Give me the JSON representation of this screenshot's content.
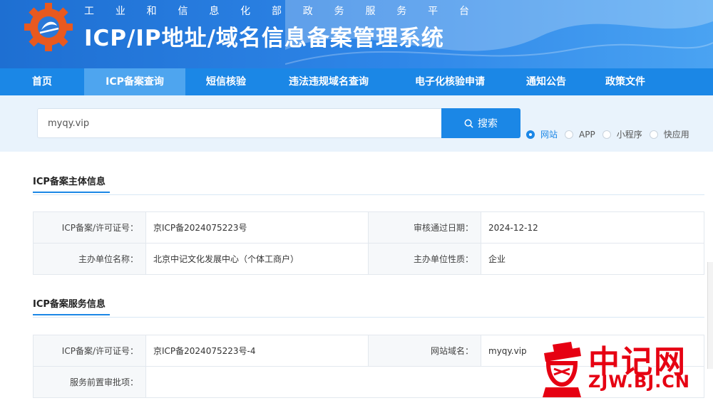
{
  "header": {
    "subtitle_chars": [
      "工",
      "业",
      "和",
      "信",
      "息",
      "化",
      "部",
      "政",
      "务",
      "服",
      "务",
      "平",
      "台"
    ],
    "title": "ICP/IP地址/域名信息备案管理系统"
  },
  "nav": {
    "items": [
      {
        "label": "首页",
        "width": 118
      },
      {
        "label": "ICP备案查询",
        "width": 142,
        "active": true
      },
      {
        "label": "短信核验",
        "width": 114
      },
      {
        "label": "违法违规域名查询",
        "width": 174
      },
      {
        "label": "电子化核验申请",
        "width": 166
      },
      {
        "label": "通知公告",
        "width": 104
      },
      {
        "label": "政策文件",
        "width": 118
      }
    ]
  },
  "search": {
    "value": "myqy.vip",
    "button_label": "搜索",
    "options": [
      {
        "label": "网站",
        "checked": true
      },
      {
        "label": "APP",
        "checked": false
      },
      {
        "label": "小程序",
        "checked": false
      },
      {
        "label": "快应用",
        "checked": false
      }
    ]
  },
  "subject": {
    "title": "ICP备案主体信息",
    "license_label": "ICP备案/许可证号：",
    "license_value": "京ICP备2024075223号",
    "date_label": "审核通过日期：",
    "date_value": "2024-12-12",
    "org_label": "主办单位名称：",
    "org_value": "北京中记文化发展中心（个体工商户）",
    "nature_label": "主办单位性质：",
    "nature_value": "企业"
  },
  "service": {
    "title": "ICP备案服务信息",
    "license_label": "ICP备案/许可证号：",
    "license_value": "京ICP备2024075223号-4",
    "domain_label": "网站域名：",
    "domain_value": "myqy.vip",
    "approval_label": "服务前置审批项：",
    "approval_value": ""
  },
  "watermark": {
    "text": "中记网",
    "sub": "ZJW.BJ.CN"
  },
  "colors": {
    "primary": "#1b87e6",
    "header_start": "#1e6fd2",
    "band": "#e9f3fc",
    "watermark": "#e60012"
  }
}
